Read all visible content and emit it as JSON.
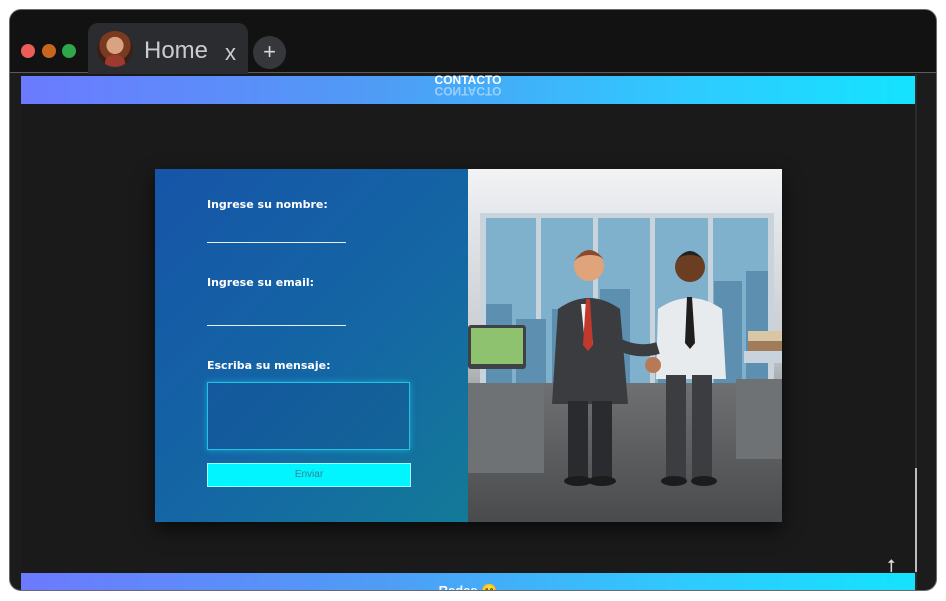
{
  "browser": {
    "tab": {
      "title": "Home",
      "close": "x",
      "avatar_icon": "profile-avatar"
    },
    "new_tab": "+",
    "traffic_lights": {
      "close": "#ec5d5a",
      "minimize": "#c7661c",
      "maximize": "#2fa64a"
    }
  },
  "page": {
    "header": {
      "title": "CONTACTO"
    },
    "form": {
      "name_label": "Ingrese su nombre:",
      "email_label": "Ingrese su email:",
      "message_label": "Escriba su mensaje:",
      "submit_label": "Enviar"
    },
    "illustration": {
      "subject": "two businessmen shaking hands in an office"
    },
    "footer": {
      "title": "Redes 😄"
    },
    "scroll_top_icon": "⭡",
    "colors": {
      "accent": "#00f5ff",
      "header_gradient_start": "#6c7aff",
      "header_gradient_end": "#14e3ff",
      "form_panel": "#1466a4"
    }
  }
}
